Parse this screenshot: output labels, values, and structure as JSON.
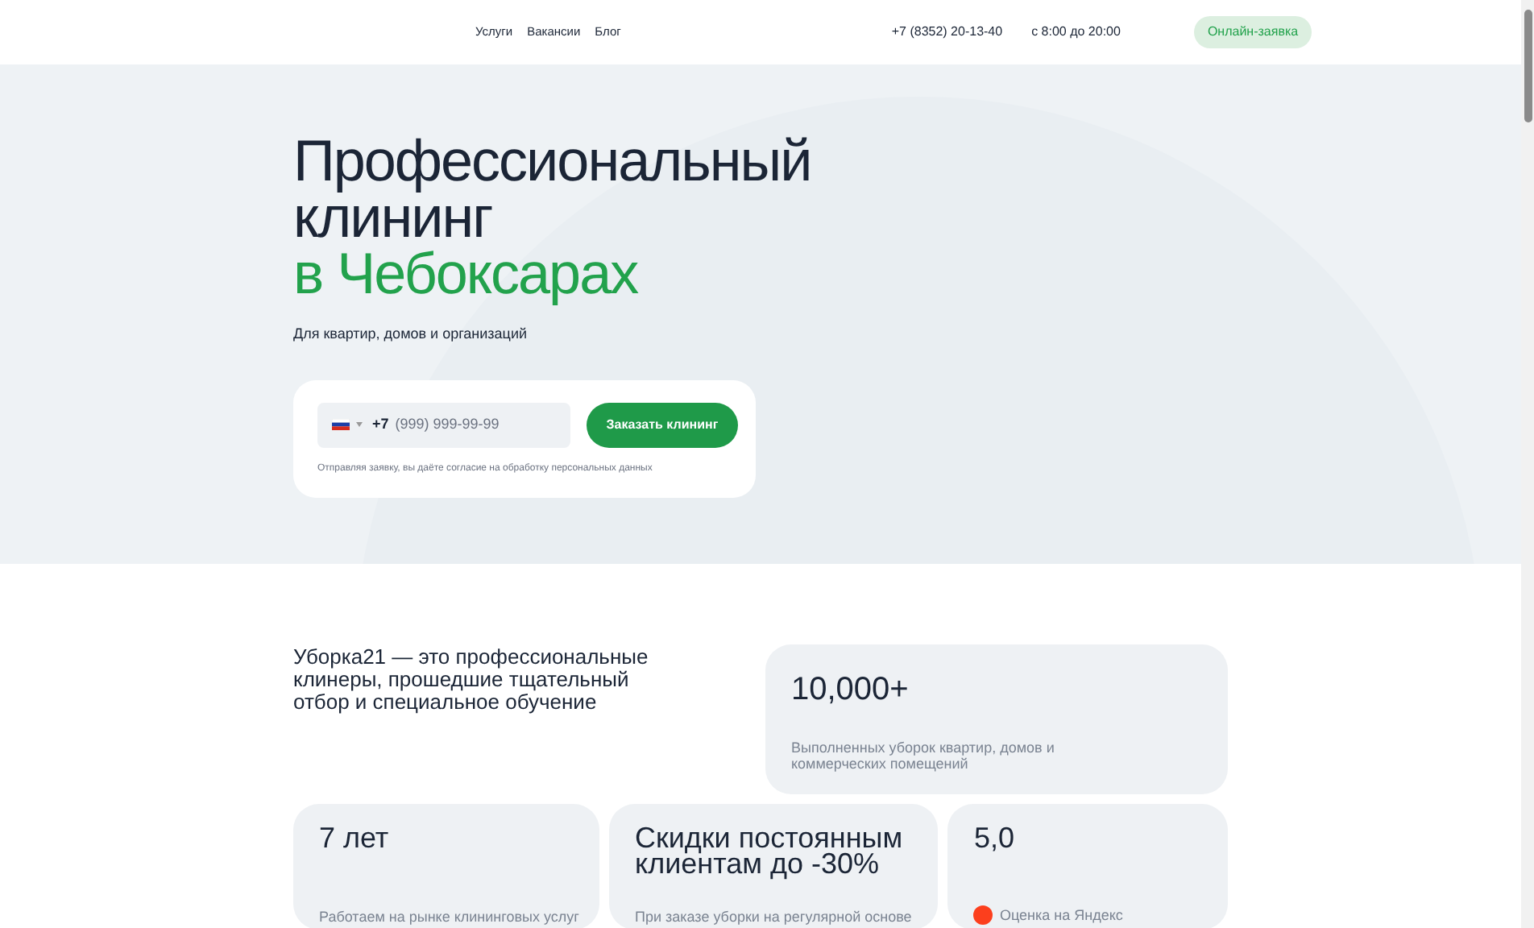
{
  "header": {
    "nav": [
      "Услуги",
      "Вакансии",
      "Блог"
    ],
    "phone": "+7 (8352) 20-13-40",
    "hours": "с 8:00 до 20:00",
    "cta": "Онлайн-заявка"
  },
  "hero": {
    "title_lines": [
      "Профессиональный",
      "клининг"
    ],
    "title_accent": "в Чебоксарах",
    "subtitle": "Для квартир, домов и организаций",
    "form": {
      "country_code": "+7",
      "placeholder": "(999) 999-99-99",
      "button": "Заказать клининг",
      "consent": "Отправляя заявку, вы даёте согласие на обработку персональных данных"
    }
  },
  "about": {
    "text": "Уборка21 — это профессиональные клинеры, прошедшие тщательный отбор и специальное обучение"
  },
  "stats": [
    {
      "kind": "plain",
      "value": "10,000+",
      "caption": "Выполненных уборок квартир, домов и коммерческих помещений"
    },
    {
      "kind": "plain",
      "value": "7 лет",
      "caption": "Работаем на рынке клининговых услуг"
    },
    {
      "kind": "plain",
      "value": "Скидки постоянным клиентам до -30%",
      "caption": "При заказе уборки на регулярной основе"
    },
    {
      "kind": "rating",
      "value": "5,0",
      "caption": "Оценка на Яндекс"
    }
  ]
}
